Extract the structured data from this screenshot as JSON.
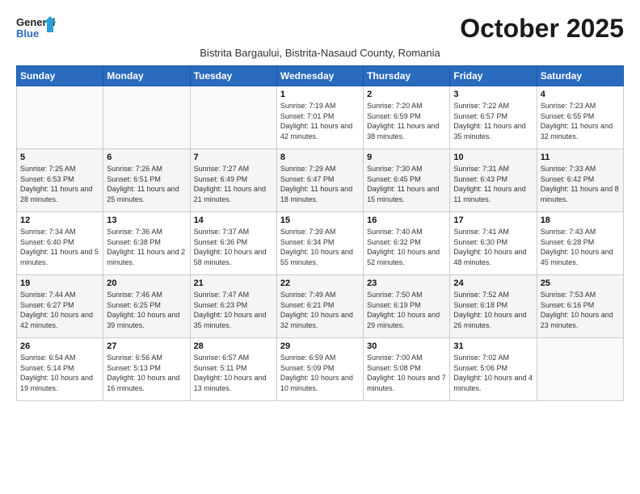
{
  "logo": {
    "line1": "General",
    "line2": "Blue"
  },
  "title": "October 2025",
  "subtitle": "Bistrita Bargaului, Bistrita-Nasaud County, Romania",
  "weekdays": [
    "Sunday",
    "Monday",
    "Tuesday",
    "Wednesday",
    "Thursday",
    "Friday",
    "Saturday"
  ],
  "weeks": [
    [
      {
        "day": "",
        "info": ""
      },
      {
        "day": "",
        "info": ""
      },
      {
        "day": "",
        "info": ""
      },
      {
        "day": "1",
        "info": "Sunrise: 7:19 AM\nSunset: 7:01 PM\nDaylight: 11 hours and 42 minutes."
      },
      {
        "day": "2",
        "info": "Sunrise: 7:20 AM\nSunset: 6:59 PM\nDaylight: 11 hours and 38 minutes."
      },
      {
        "day": "3",
        "info": "Sunrise: 7:22 AM\nSunset: 6:57 PM\nDaylight: 11 hours and 35 minutes."
      },
      {
        "day": "4",
        "info": "Sunrise: 7:23 AM\nSunset: 6:55 PM\nDaylight: 11 hours and 32 minutes."
      }
    ],
    [
      {
        "day": "5",
        "info": "Sunrise: 7:25 AM\nSunset: 6:53 PM\nDaylight: 11 hours and 28 minutes."
      },
      {
        "day": "6",
        "info": "Sunrise: 7:26 AM\nSunset: 6:51 PM\nDaylight: 11 hours and 25 minutes."
      },
      {
        "day": "7",
        "info": "Sunrise: 7:27 AM\nSunset: 6:49 PM\nDaylight: 11 hours and 21 minutes."
      },
      {
        "day": "8",
        "info": "Sunrise: 7:29 AM\nSunset: 6:47 PM\nDaylight: 11 hours and 18 minutes."
      },
      {
        "day": "9",
        "info": "Sunrise: 7:30 AM\nSunset: 6:45 PM\nDaylight: 11 hours and 15 minutes."
      },
      {
        "day": "10",
        "info": "Sunrise: 7:31 AM\nSunset: 6:43 PM\nDaylight: 11 hours and 11 minutes."
      },
      {
        "day": "11",
        "info": "Sunrise: 7:33 AM\nSunset: 6:42 PM\nDaylight: 11 hours and 8 minutes."
      }
    ],
    [
      {
        "day": "12",
        "info": "Sunrise: 7:34 AM\nSunset: 6:40 PM\nDaylight: 11 hours and 5 minutes."
      },
      {
        "day": "13",
        "info": "Sunrise: 7:36 AM\nSunset: 6:38 PM\nDaylight: 11 hours and 2 minutes."
      },
      {
        "day": "14",
        "info": "Sunrise: 7:37 AM\nSunset: 6:36 PM\nDaylight: 10 hours and 58 minutes."
      },
      {
        "day": "15",
        "info": "Sunrise: 7:39 AM\nSunset: 6:34 PM\nDaylight: 10 hours and 55 minutes."
      },
      {
        "day": "16",
        "info": "Sunrise: 7:40 AM\nSunset: 6:32 PM\nDaylight: 10 hours and 52 minutes."
      },
      {
        "day": "17",
        "info": "Sunrise: 7:41 AM\nSunset: 6:30 PM\nDaylight: 10 hours and 48 minutes."
      },
      {
        "day": "18",
        "info": "Sunrise: 7:43 AM\nSunset: 6:28 PM\nDaylight: 10 hours and 45 minutes."
      }
    ],
    [
      {
        "day": "19",
        "info": "Sunrise: 7:44 AM\nSunset: 6:27 PM\nDaylight: 10 hours and 42 minutes."
      },
      {
        "day": "20",
        "info": "Sunrise: 7:46 AM\nSunset: 6:25 PM\nDaylight: 10 hours and 39 minutes."
      },
      {
        "day": "21",
        "info": "Sunrise: 7:47 AM\nSunset: 6:23 PM\nDaylight: 10 hours and 35 minutes."
      },
      {
        "day": "22",
        "info": "Sunrise: 7:49 AM\nSunset: 6:21 PM\nDaylight: 10 hours and 32 minutes."
      },
      {
        "day": "23",
        "info": "Sunrise: 7:50 AM\nSunset: 6:19 PM\nDaylight: 10 hours and 29 minutes."
      },
      {
        "day": "24",
        "info": "Sunrise: 7:52 AM\nSunset: 6:18 PM\nDaylight: 10 hours and 26 minutes."
      },
      {
        "day": "25",
        "info": "Sunrise: 7:53 AM\nSunset: 6:16 PM\nDaylight: 10 hours and 23 minutes."
      }
    ],
    [
      {
        "day": "26",
        "info": "Sunrise: 6:54 AM\nSunset: 5:14 PM\nDaylight: 10 hours and 19 minutes."
      },
      {
        "day": "27",
        "info": "Sunrise: 6:56 AM\nSunset: 5:13 PM\nDaylight: 10 hours and 16 minutes."
      },
      {
        "day": "28",
        "info": "Sunrise: 6:57 AM\nSunset: 5:11 PM\nDaylight: 10 hours and 13 minutes."
      },
      {
        "day": "29",
        "info": "Sunrise: 6:59 AM\nSunset: 5:09 PM\nDaylight: 10 hours and 10 minutes."
      },
      {
        "day": "30",
        "info": "Sunrise: 7:00 AM\nSunset: 5:08 PM\nDaylight: 10 hours and 7 minutes."
      },
      {
        "day": "31",
        "info": "Sunrise: 7:02 AM\nSunset: 5:06 PM\nDaylight: 10 hours and 4 minutes."
      },
      {
        "day": "",
        "info": ""
      }
    ]
  ]
}
